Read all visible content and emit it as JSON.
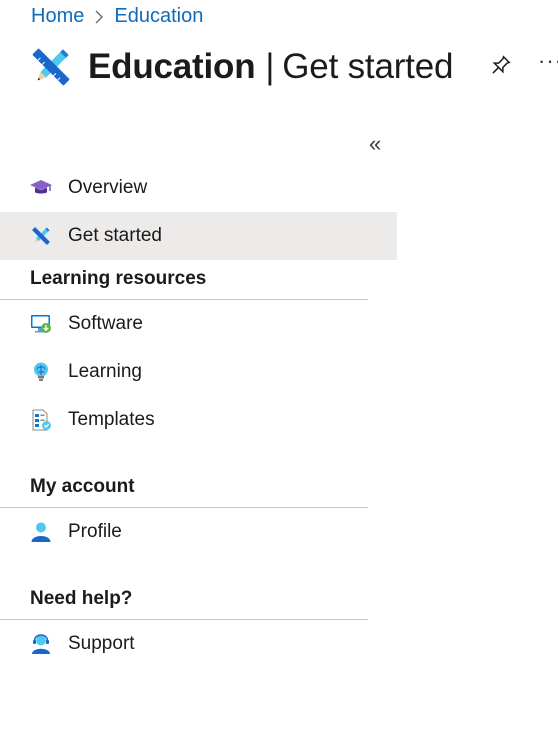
{
  "breadcrumb": {
    "items": [
      "Home",
      "Education"
    ]
  },
  "header": {
    "title_main": "Education",
    "title_separator": "|",
    "title_sub": "Get started",
    "icons": [
      "education-tools-icon",
      "pin-icon",
      "more-icon"
    ],
    "more_label": "···"
  },
  "sidebar": {
    "collapse_label": "«",
    "top_items": [
      {
        "label": "Overview",
        "icon": "graduation-cap-icon"
      },
      {
        "label": "Get started",
        "icon": "education-tools-icon",
        "selected": true
      }
    ],
    "sections": [
      {
        "title": "Learning resources",
        "items": [
          {
            "label": "Software",
            "icon": "monitor-download-icon"
          },
          {
            "label": "Learning",
            "icon": "lightbulb-icon"
          },
          {
            "label": "Templates",
            "icon": "templates-icon"
          }
        ]
      },
      {
        "title": "My account",
        "items": [
          {
            "label": "Profile",
            "icon": "user-icon"
          }
        ]
      },
      {
        "title": "Need help?",
        "items": [
          {
            "label": "Support",
            "icon": "support-person-icon"
          }
        ]
      }
    ]
  },
  "colors": {
    "link": "#0f6cbd",
    "selected_bg": "#edebe9",
    "divider": "#c8c6c4"
  }
}
